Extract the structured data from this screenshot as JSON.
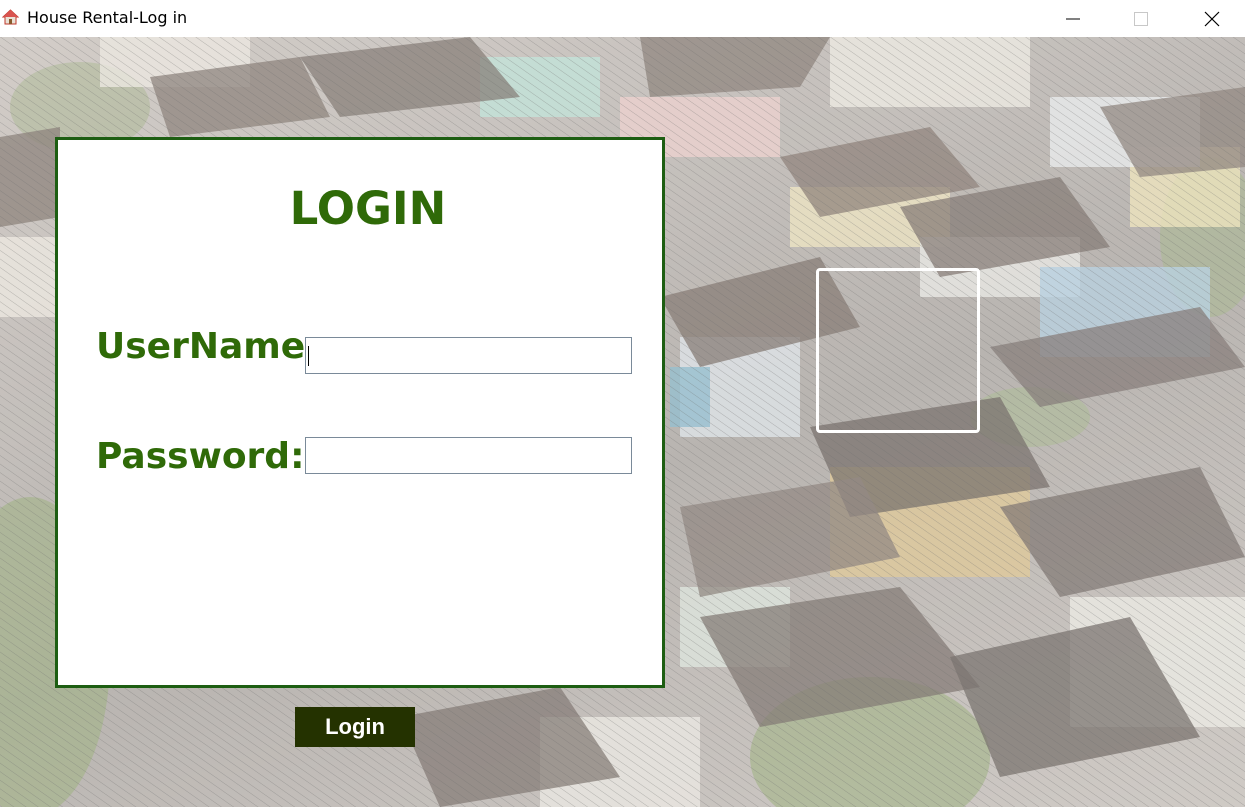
{
  "window": {
    "title": "House Rental-Log in",
    "icon": "house-icon",
    "controls": {
      "minimize_icon": "minimize-icon",
      "maximize_icon": "maximize-icon",
      "close_icon": "close-icon"
    }
  },
  "login": {
    "title": "LOGIN",
    "username_label": "UserName:",
    "password_label": "Password:",
    "username_value": "",
    "password_value": "",
    "button_label": "Login"
  },
  "colors": {
    "accent_green": "#2f6a08",
    "panel_border": "#1d5e12",
    "button_bg": "#243200"
  }
}
